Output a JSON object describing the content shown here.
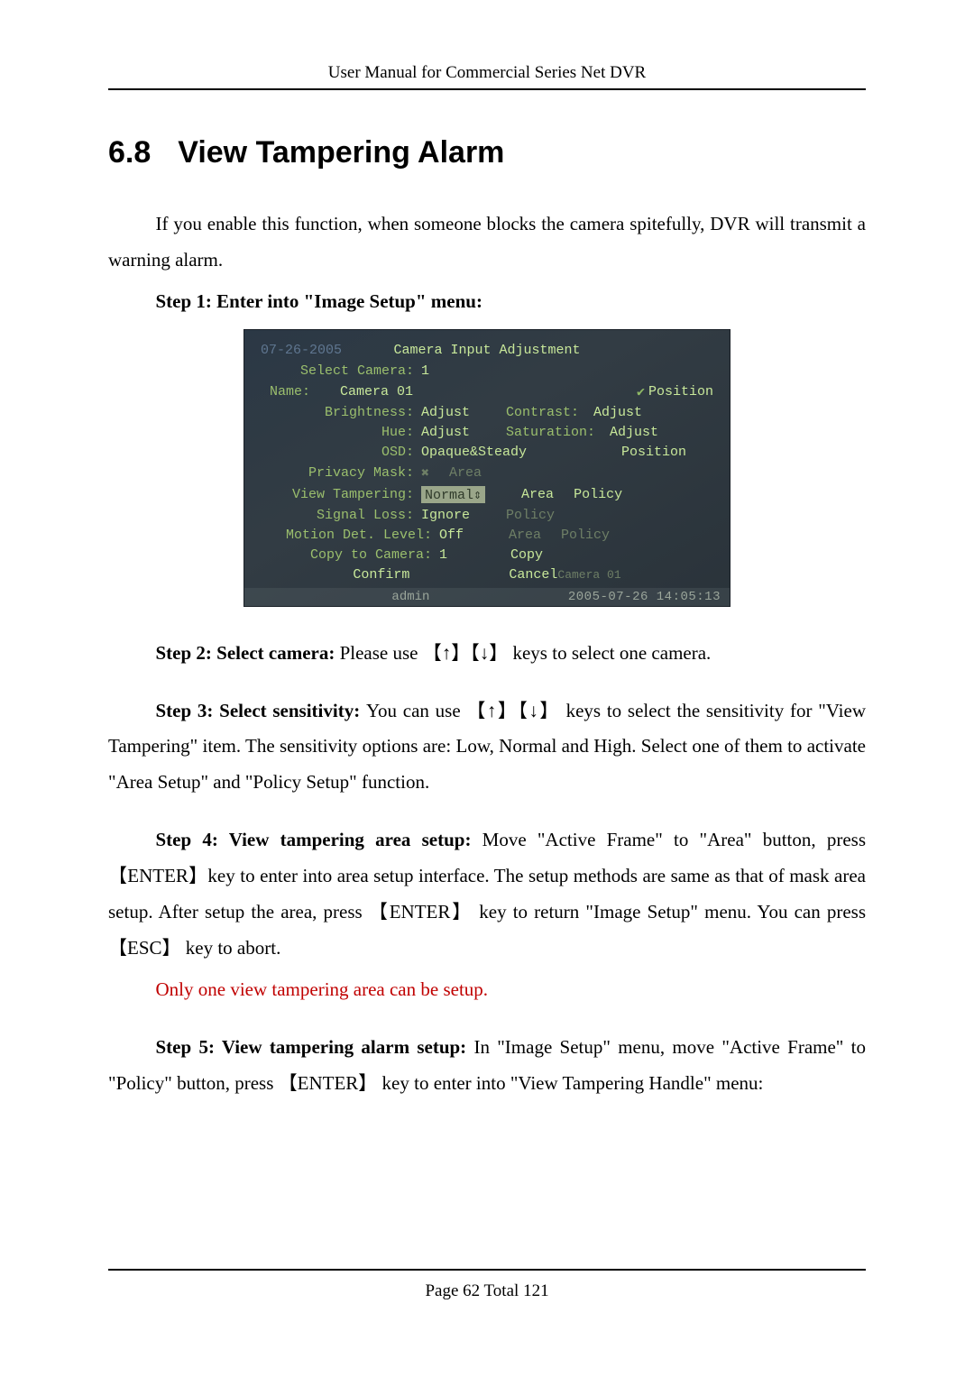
{
  "header": "User Manual for Commercial Series Net DVR",
  "section": {
    "number": "6.8",
    "title": "View Tampering Alarm"
  },
  "intro": "If you enable this function, when someone blocks the camera spitefully, DVR will transmit a warning alarm.",
  "step1_label": "Step 1: Enter into \"Image Setup\" menu:",
  "dvr": {
    "bg_date": "07-26-2005",
    "title": "Camera Input Adjustment",
    "select_camera_label": "Select Camera:",
    "select_camera_val": "1",
    "name_label": "Name:",
    "name_val": "Camera 01",
    "position_btn": "Position",
    "brightness_label": "Brightness:",
    "brightness_val": "Adjust",
    "contrast_label": "Contrast:",
    "contrast_val": "Adjust",
    "hue_label": "Hue:",
    "hue_val": "Adjust",
    "saturation_label": "Saturation:",
    "saturation_val": "Adjust",
    "osd_label": "OSD:",
    "osd_val": "Opaque&Steady",
    "osd_position": "Position",
    "privacy_label": "Privacy Mask:",
    "privacy_area": "Area",
    "vt_label": "View Tampering:",
    "vt_val": "Normal⇕",
    "vt_area": "Area",
    "vt_policy": "Policy",
    "signal_label": "Signal Loss:",
    "signal_val": "Ignore",
    "signal_policy": "Policy",
    "motion_label": "Motion Det. Level:",
    "motion_val": "Off",
    "motion_area": "Area",
    "motion_policy": "Policy",
    "copy_label": "Copy to Camera:",
    "copy_val": "1",
    "copy_btn": "Copy",
    "confirm": "Confirm",
    "cancel": "Cancel",
    "bg_cam": "Camera 01",
    "footer_user": "admin",
    "footer_time": "2005-07-26 14:05:13"
  },
  "step2_label": "Step 2: Select camera: ",
  "step2_text": "Please use 【↑】【↓】 keys to select one camera.",
  "step3_label": "Step 3: Select sensitivity: ",
  "step3_text": "You can use 【↑】【↓】 keys to select the sensitivity for \"View Tampering\" item. The sensitivity options are: Low, Normal and High. Select one of them to activate \"Area Setup\" and \"Policy Setup\" function.",
  "step4_label": "Step 4: View tampering area setup: ",
  "step4_text": "Move \"Active Frame\" to \"Area\" button, press 【ENTER】key to enter into area setup interface. The setup methods are same as that of mask area setup. After setup the area, press 【ENTER】 key to return \"Image Setup\" menu. You can press 【ESC】 key to abort.",
  "note_red": "Only one view tampering area can be setup.",
  "step5_label": "Step 5: View tampering alarm setup: ",
  "step5_text": "In \"Image Setup\" menu, move \"Active Frame\" to \"Policy\" button, press 【ENTER】 key to enter into \"View Tampering Handle\" menu:",
  "footer": {
    "prefix": "Page ",
    "current": "62",
    "middle": " Total ",
    "total": "121"
  }
}
